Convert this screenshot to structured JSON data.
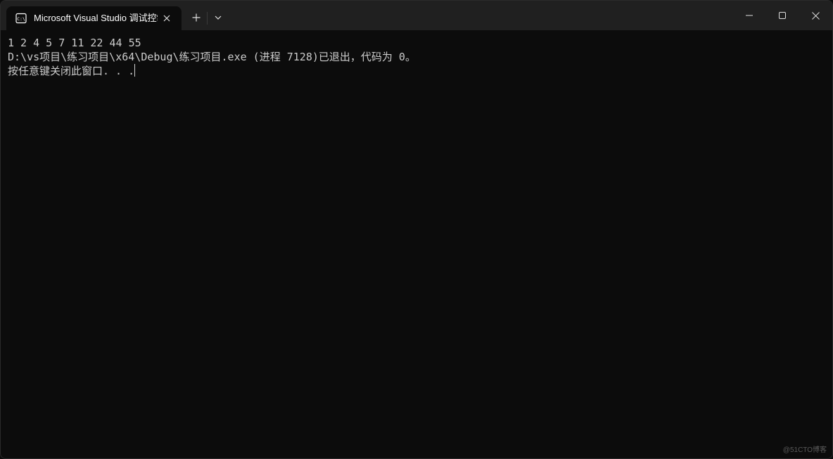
{
  "tab": {
    "icon": "console-icon",
    "icon_text": "C:\\",
    "title": "Microsoft Visual Studio 调试控制台"
  },
  "icons": {
    "close_tab": "close-icon",
    "new_tab": "plus-icon",
    "tab_menu": "chevron-down-icon",
    "minimize": "minimize-icon",
    "maximize": "maximize-icon",
    "close_window": "close-icon"
  },
  "console": {
    "lines": [
      "1 2 4 5 7 11 22 44 55",
      "D:\\vs项目\\练习项目\\x64\\Debug\\练习项目.exe (进程 7128)已退出，代码为 0。",
      "按任意键关闭此窗口. . ."
    ]
  },
  "watermark": "@51CTO博客",
  "colors": {
    "background": "#0c0c0c",
    "titlebar": "#202020",
    "text": "#cccccc"
  }
}
